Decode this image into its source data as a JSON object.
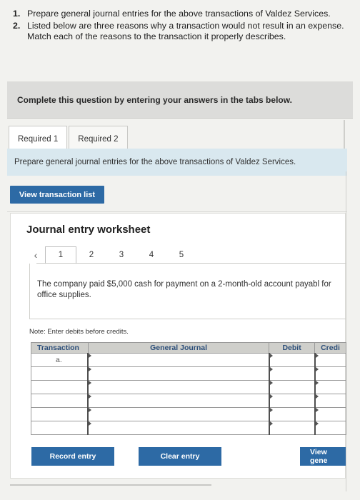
{
  "instructions": [
    {
      "num": "1.",
      "text": "Prepare general journal entries for the above transactions of Valdez Services."
    },
    {
      "num": "2.",
      "text": "Listed below are three reasons why a transaction would not result in an expense. Match each of the reasons to the transaction it properly describes."
    }
  ],
  "banner": "Complete this question by entering your answers in the tabs below.",
  "tabs": [
    {
      "label": "Required 1",
      "active": true
    },
    {
      "label": "Required 2",
      "active": false
    }
  ],
  "info_text": "Prepare general journal entries for the above transactions of Valdez Services.",
  "view_transactions_label": "View transaction list",
  "worksheet": {
    "title": "Journal entry worksheet",
    "prev_icon": "chevron-left-icon",
    "pages": [
      "1",
      "2",
      "3",
      "4",
      "5"
    ],
    "active_page": "1",
    "description": "The company paid $5,000 cash for payment on a 2-month-old account payabl for office supplies.",
    "note": "Note: Enter debits before credits."
  },
  "table": {
    "headers": [
      "Transaction",
      "General Journal",
      "Debit",
      "Credi"
    ],
    "rows": [
      {
        "transaction": "a.",
        "account": "",
        "debit": "",
        "credit": ""
      },
      {
        "transaction": "",
        "account": "",
        "debit": "",
        "credit": ""
      },
      {
        "transaction": "",
        "account": "",
        "debit": "",
        "credit": ""
      },
      {
        "transaction": "",
        "account": "",
        "debit": "",
        "credit": ""
      },
      {
        "transaction": "",
        "account": "",
        "debit": "",
        "credit": ""
      },
      {
        "transaction": "",
        "account": "",
        "debit": "",
        "credit": ""
      }
    ]
  },
  "buttons": {
    "record": "Record entry",
    "clear": "Clear entry",
    "view_general": "View gene"
  },
  "colors": {
    "button_blue": "#2d6aa5",
    "info_bar": "#d9e8ef",
    "header_text": "#2d4f7a"
  }
}
